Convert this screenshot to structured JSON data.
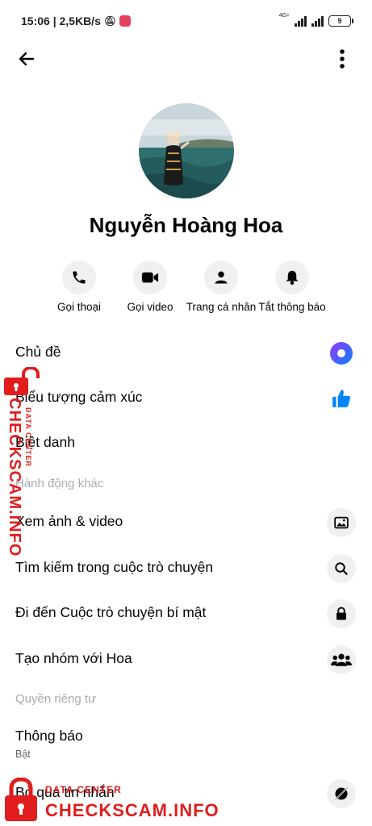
{
  "status_bar": {
    "time_speed": "15:06 | 2,5KB/s",
    "network": "4G+",
    "battery": "9"
  },
  "top_bar": {
    "back_icon": "arrow-left-icon",
    "more_icon": "more-vertical-icon"
  },
  "profile": {
    "name": "Nguyễn Hoàng Hoa"
  },
  "actions": [
    {
      "label": "Gọi thoại",
      "icon": "phone-icon"
    },
    {
      "label": "Gọi video",
      "icon": "video-icon"
    },
    {
      "label": "Trang cá nhân",
      "icon": "person-icon"
    },
    {
      "label": "Tắt thông báo",
      "icon": "bell-icon"
    }
  ],
  "menu": {
    "theme": "Chủ đề",
    "emoji": "Biểu tượng cảm xúc",
    "nickname": "Biệt danh",
    "section_more_actions": "Hành động khác",
    "media": "Xem ảnh & video",
    "search": "Tìm kiếm trong cuộc trò chuyện",
    "secret": "Đi đến Cuộc trò chuyện bí mật",
    "group": "Tạo nhóm với Hoa",
    "section_privacy": "Quyền riêng tư",
    "notifications": "Thông báo",
    "notifications_status": "Bật",
    "ignore": "Bỏ qua tin nhắn"
  },
  "colors": {
    "accent": "#0084ff",
    "theme_gradient_start": "#a033ff",
    "theme_gradient_end": "#0084ff",
    "watermark": "#e11d1d"
  },
  "watermark": {
    "text": "CHECKSCAM.INFO",
    "sub": "DATA CENTER"
  }
}
